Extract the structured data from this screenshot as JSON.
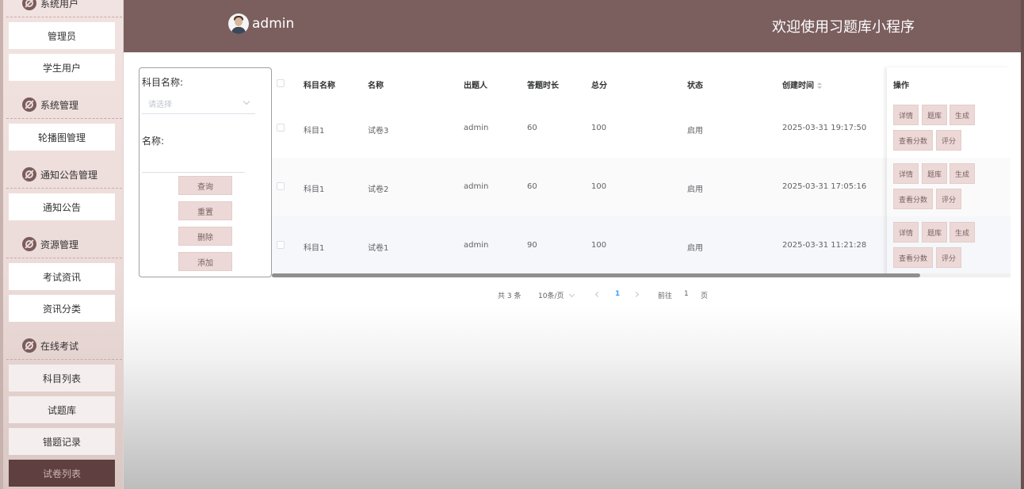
{
  "header": {
    "username": "admin",
    "welcome": "欢迎使用习题库小程序"
  },
  "sidebar": {
    "top_partial": "系统用户",
    "items": [
      {
        "label": "管理员"
      },
      {
        "label": "学生用户"
      },
      {
        "group": "系统管理"
      },
      {
        "label": "轮播图管理"
      },
      {
        "group": "通知公告管理"
      },
      {
        "label": "通知公告"
      },
      {
        "group": "资源管理"
      },
      {
        "label": "考试资讯"
      },
      {
        "label": "资讯分类"
      },
      {
        "group": "在线考试"
      },
      {
        "label": "科目列表"
      },
      {
        "label": "试题库"
      },
      {
        "label": "错题记录"
      },
      {
        "label": "试卷列表",
        "active": true
      }
    ]
  },
  "search": {
    "subject_label": "科目名称:",
    "subject_placeholder": "请选择",
    "name_label": "名称:",
    "buttons": {
      "query": "查询",
      "reset": "重置",
      "delete": "删除",
      "add": "添加"
    }
  },
  "table": {
    "columns": [
      "科目名称",
      "名称",
      "出题人",
      "答题时长",
      "总分",
      "状态",
      "创建时间",
      "操作"
    ],
    "rows": [
      {
        "subject": "科目1",
        "name": "试卷3",
        "author": "admin",
        "duration": "60",
        "total": "100",
        "status": "启用",
        "created": "2025-03-31 19:17:50"
      },
      {
        "subject": "科目1",
        "name": "试卷2",
        "author": "admin",
        "duration": "60",
        "total": "100",
        "status": "启用",
        "created": "2025-03-31 17:05:16"
      },
      {
        "subject": "科目1",
        "name": "试卷1",
        "author": "admin",
        "duration": "90",
        "total": "100",
        "status": "启用",
        "created": "2025-03-31 11:21:28"
      }
    ],
    "ops": {
      "detail": "详情",
      "bank": "题库",
      "generate": "生成",
      "scores": "查看分数",
      "grade": "评分"
    }
  },
  "pagination": {
    "total": "共 3 条",
    "page_size": "10条/页",
    "current": "1",
    "goto": "前往",
    "goto_value": "1",
    "page_suffix": "页"
  }
}
